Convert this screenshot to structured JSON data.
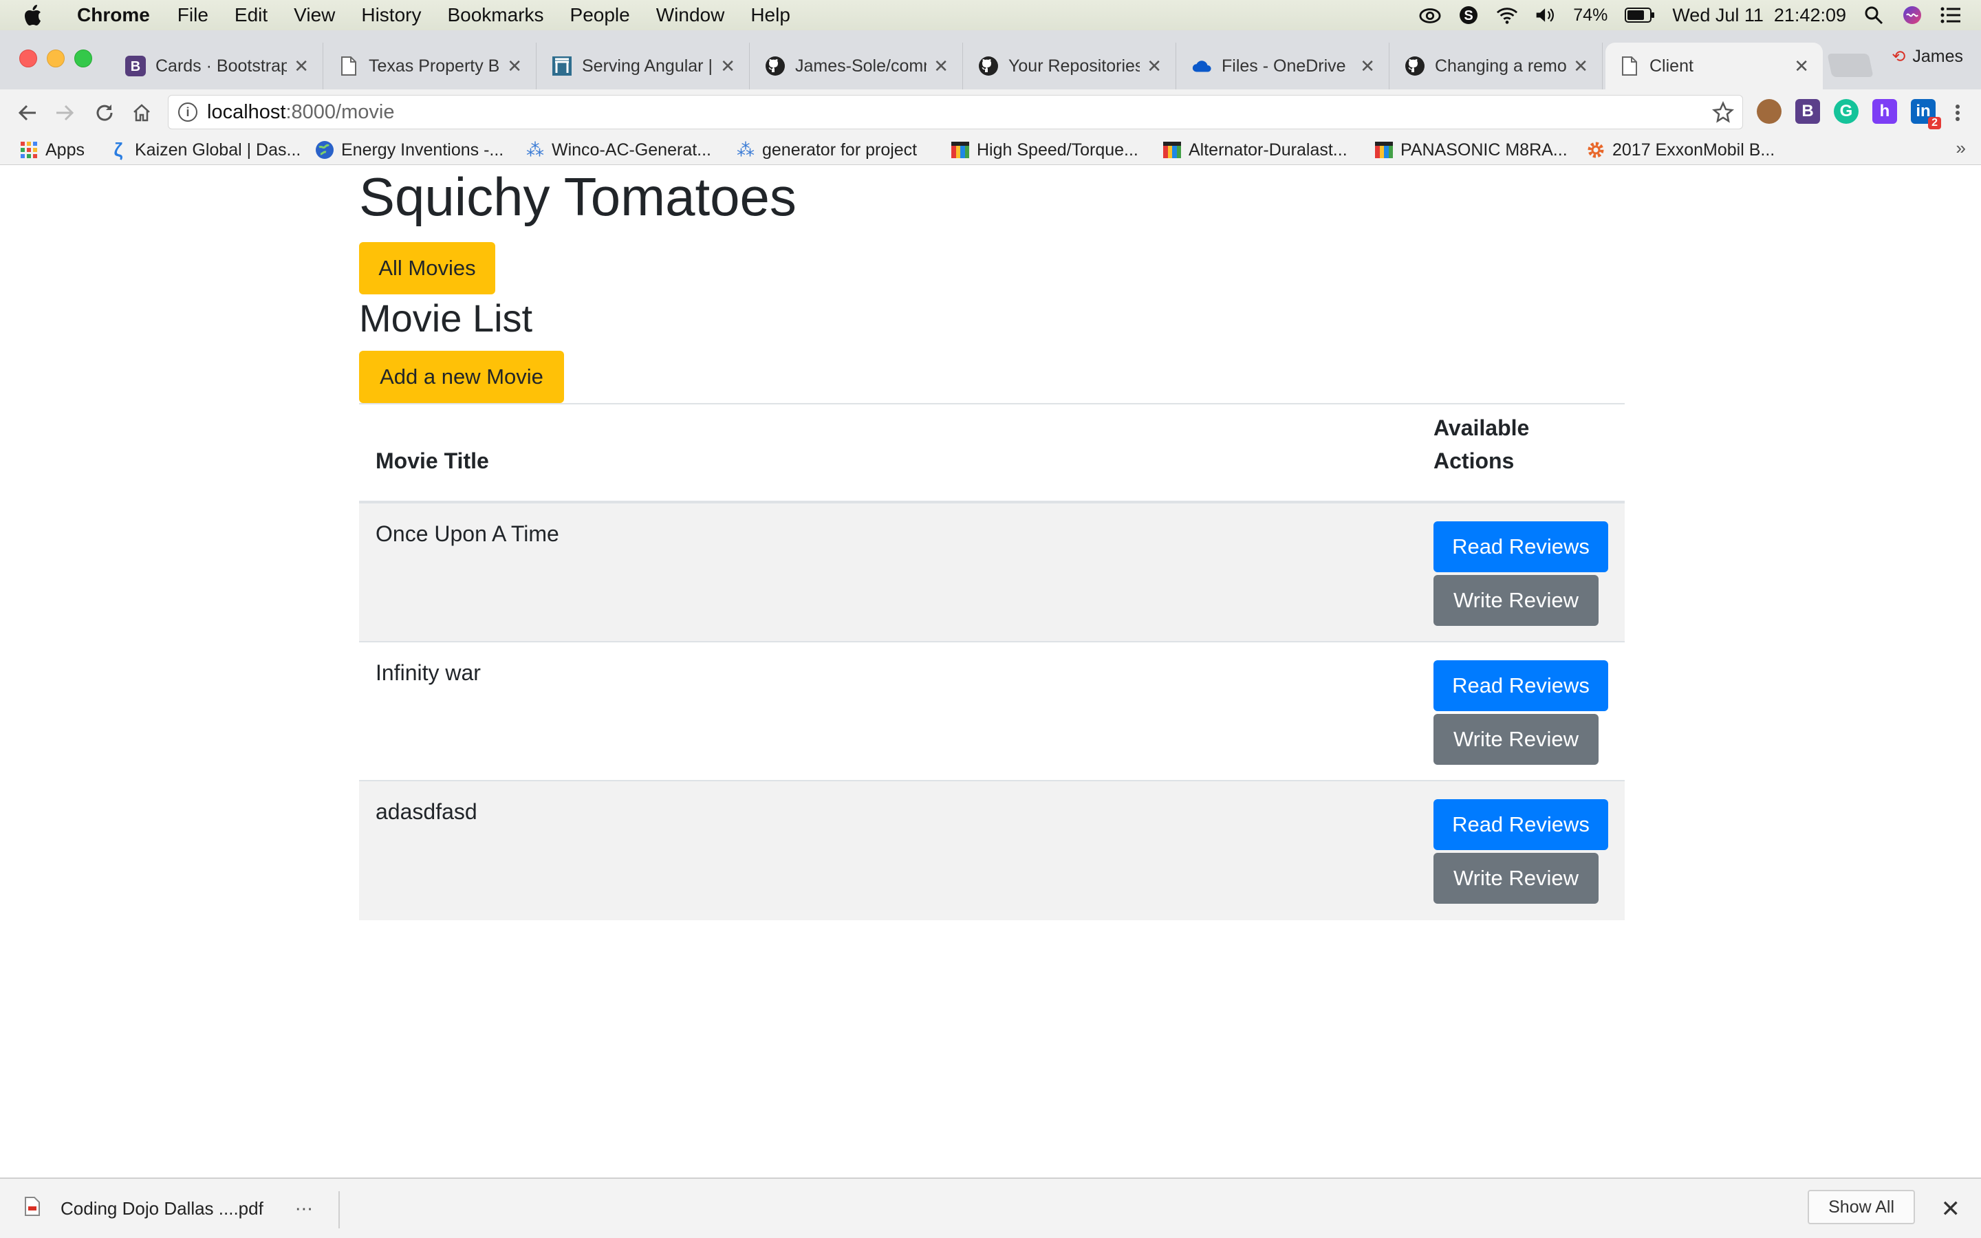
{
  "menubar": {
    "app_name": "Chrome",
    "items": [
      "File",
      "Edit",
      "View",
      "History",
      "Bookmarks",
      "People",
      "Window",
      "Help"
    ],
    "battery": "74%",
    "datetime": "Wed Jul 11  21:42:09"
  },
  "tabs": [
    {
      "label": "Cards · Bootstrap",
      "icon": "bootstrap-icon"
    },
    {
      "label": "Texas Property Bu",
      "icon": "page-icon"
    },
    {
      "label": "Serving Angular |",
      "icon": "gate-icon"
    },
    {
      "label": "James-Sole/comn",
      "icon": "github-icon"
    },
    {
      "label": "Your Repositories",
      "icon": "github-icon"
    },
    {
      "label": "Files - OneDrive",
      "icon": "onedrive-icon"
    },
    {
      "label": "Changing a remot",
      "icon": "github-icon"
    },
    {
      "label": "Client",
      "icon": "page-icon"
    }
  ],
  "profile_name": "James",
  "address": {
    "host": "localhost",
    "path": ":8000/movie"
  },
  "bookmarks": [
    {
      "label": "Apps",
      "icon": "apps-grid-icon"
    },
    {
      "label": "Kaizen Global | Das...",
      "icon": "kaizen-icon"
    },
    {
      "label": "Energy Inventions -...",
      "icon": "globe-icon"
    },
    {
      "label": "Winco-AC-Generat...",
      "icon": "splash-icon"
    },
    {
      "label": "generator for project",
      "icon": "splash-icon"
    },
    {
      "label": "High Speed/Torque...",
      "icon": "store-icon"
    },
    {
      "label": "Alternator-Duralast...",
      "icon": "store-icon"
    },
    {
      "label": "PANASONIC M8RA...",
      "icon": "store-icon"
    },
    {
      "label": "2017 ExxonMobil B...",
      "icon": "gear-icon"
    }
  ],
  "page": {
    "brand": "Squichy Tomatoes",
    "all_movies_button": "All Movies",
    "section_title": "Movie List",
    "add_movie_button": "Add a new Movie",
    "table": {
      "headers": {
        "title": "Movie Title",
        "actions_line1": "Available",
        "actions_line2": "Actions"
      },
      "rows": [
        {
          "title": "Once Upon A Time",
          "read": "Read Reviews",
          "write": "Write Review"
        },
        {
          "title": "Infinity war",
          "read": "Read Reviews",
          "write": "Write Review"
        },
        {
          "title": "adasdfasd",
          "read": "Read Reviews",
          "write": "Write Review"
        }
      ]
    }
  },
  "downloads": {
    "file_name": "Coding Dojo Dallas ....pdf",
    "show_all": "Show All"
  },
  "extension_badge": "2",
  "colors": {
    "warning": "#ffc107",
    "primary": "#007bff",
    "secondary": "#6c757d",
    "stripe": "#f2f2f2"
  }
}
